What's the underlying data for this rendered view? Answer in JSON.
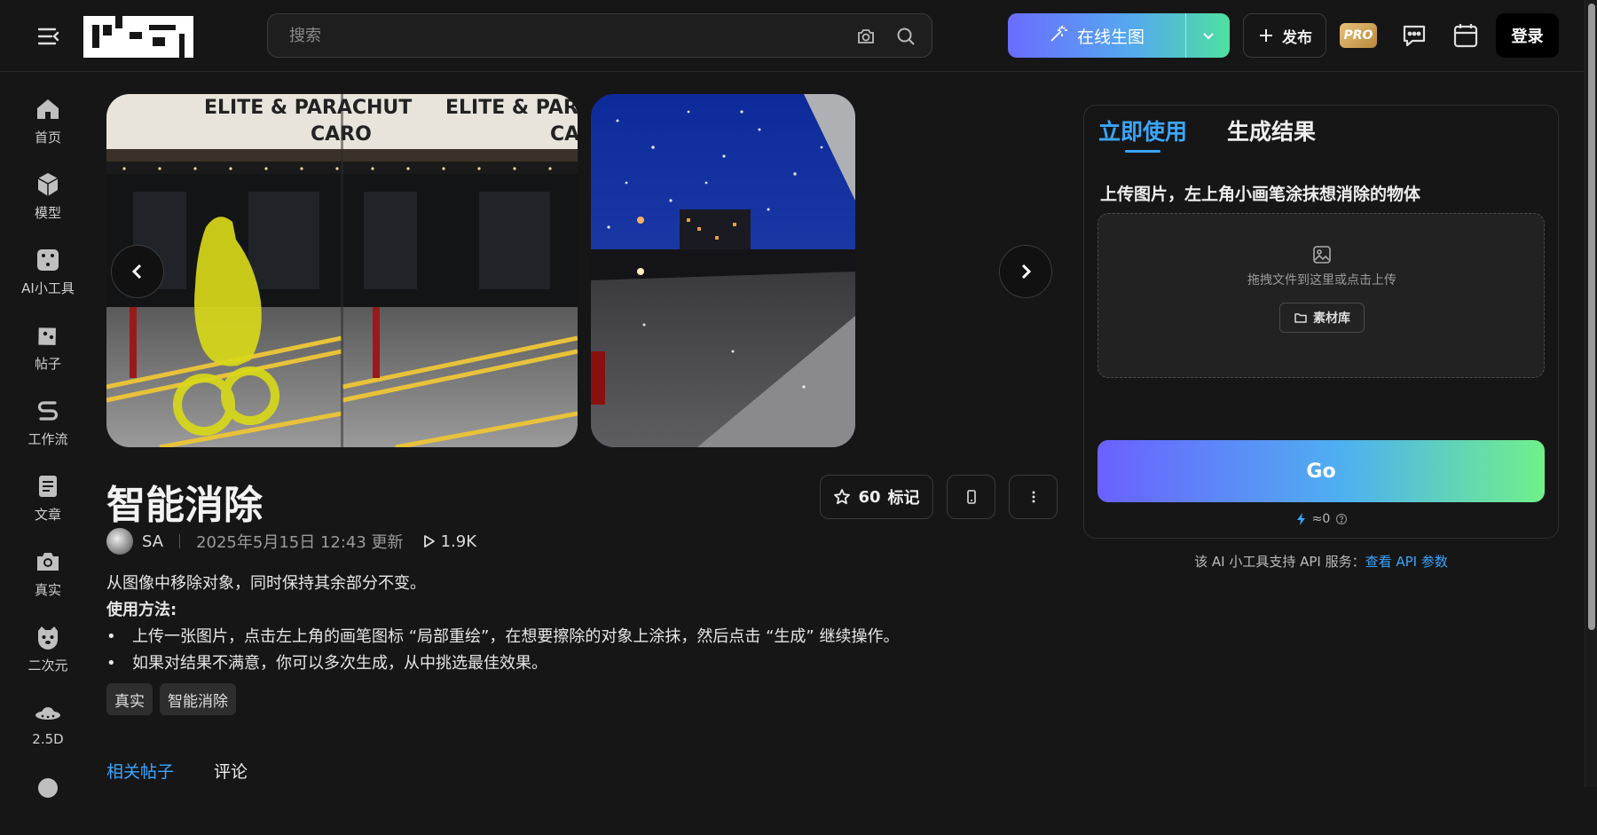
{
  "header": {
    "search_placeholder": "搜索",
    "generate_label": "在线生图",
    "publish_label": "发布",
    "pro_label": "PRO",
    "login_label": "登录"
  },
  "sidebar": {
    "items": [
      {
        "label": "首页",
        "icon": "home-icon"
      },
      {
        "label": "模型",
        "icon": "cube-icon"
      },
      {
        "label": "AI小工具",
        "icon": "dice-icon"
      },
      {
        "label": "帖子",
        "icon": "post-icon"
      },
      {
        "label": "工作流",
        "icon": "workflow-icon"
      },
      {
        "label": "文章",
        "icon": "article-icon"
      },
      {
        "label": "真实",
        "icon": "camera-icon"
      },
      {
        "label": "二次元",
        "icon": "anime-icon"
      },
      {
        "label": "2.5D",
        "icon": "ufo-icon"
      }
    ]
  },
  "tool": {
    "title": "智能消除",
    "favorite_count": "60",
    "favorite_label": "标记",
    "author": "SA",
    "updated": "2025年5月15日 12:43 更新",
    "views": "1.9K",
    "description": "从图像中移除对象，同时保持其余部分不变。",
    "usage_label": "使用方法:",
    "usage_steps": [
      "上传一张图片，点击左上角的画笔图标 “局部重绘”，在想要擦除的对象上涂抹，然后点击 “生成” 继续操作。",
      "如果对结果不满意，你可以多次生成，从中挑选最佳效果。"
    ],
    "tags": [
      "真实",
      "智能消除"
    ],
    "subtabs": [
      "相关帖子",
      "评论"
    ]
  },
  "panel": {
    "tab_use": "立即使用",
    "tab_results": "生成结果",
    "upload_label": "上传图片，左上角小画笔涂抹想消除的物体",
    "upload_hint": "拖拽文件到这里或点击上传",
    "library_label": "素材库",
    "go_label": "Go",
    "cost": "≈0",
    "api_text": "该 AI 小工具支持 API 服务：",
    "api_link": "查看 API 参数"
  },
  "colors": {
    "accent": "#3aa6ff",
    "background": "#161616"
  }
}
